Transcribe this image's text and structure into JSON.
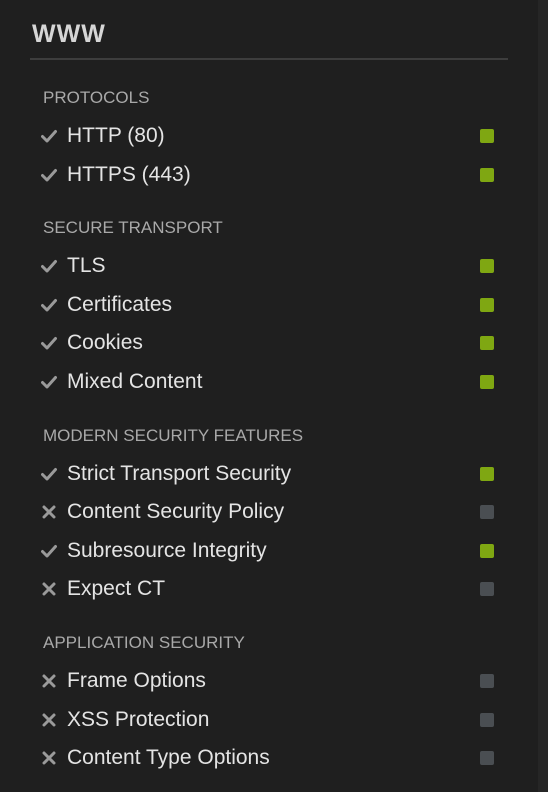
{
  "panel": {
    "title": "WWW",
    "colors": {
      "pass": "#7fa712",
      "none": "#4a4e52"
    }
  },
  "sections": [
    {
      "heading": "PROTOCOLS",
      "items": [
        {
          "label": "HTTP (80)",
          "icon": "check-icon",
          "status": "pass"
        },
        {
          "label": "HTTPS (443)",
          "icon": "check-icon",
          "status": "pass"
        }
      ]
    },
    {
      "heading": "SECURE TRANSPORT",
      "items": [
        {
          "label": "TLS",
          "icon": "check-icon",
          "status": "pass"
        },
        {
          "label": "Certificates",
          "icon": "check-icon",
          "status": "pass"
        },
        {
          "label": "Cookies",
          "icon": "check-icon",
          "status": "pass"
        },
        {
          "label": "Mixed Content",
          "icon": "check-icon",
          "status": "pass"
        }
      ]
    },
    {
      "heading": "MODERN SECURITY FEATURES",
      "items": [
        {
          "label": "Strict Transport Security",
          "icon": "check-icon",
          "status": "pass"
        },
        {
          "label": "Content Security Policy",
          "icon": "cross-icon",
          "status": "none"
        },
        {
          "label": "Subresource Integrity",
          "icon": "check-icon",
          "status": "pass"
        },
        {
          "label": "Expect CT",
          "icon": "cross-icon",
          "status": "none"
        }
      ]
    },
    {
      "heading": "APPLICATION SECURITY",
      "items": [
        {
          "label": "Frame Options",
          "icon": "cross-icon",
          "status": "none"
        },
        {
          "label": "XSS Protection",
          "icon": "cross-icon",
          "status": "none"
        },
        {
          "label": "Content Type Options",
          "icon": "cross-icon",
          "status": "none"
        }
      ]
    }
  ]
}
